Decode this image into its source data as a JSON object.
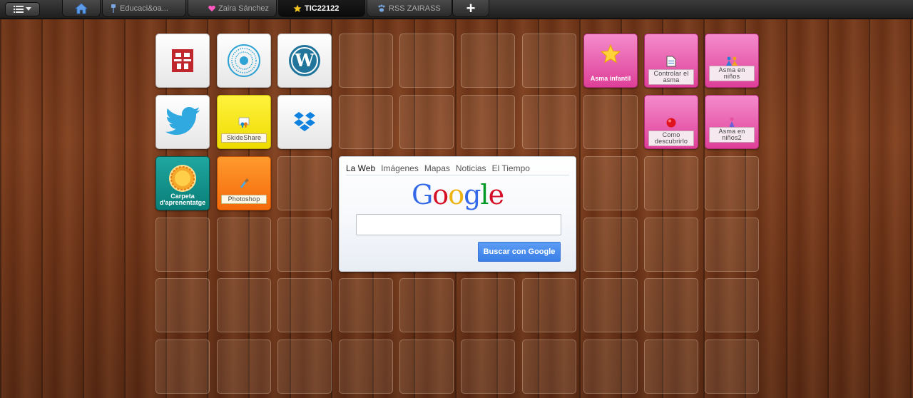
{
  "topbar": {
    "tabs": [
      {
        "label": "Educaci&oa...",
        "icon": "pin-icon",
        "active": false
      },
      {
        "label": "Zaira Sánchez",
        "icon": "heart-icon",
        "active": false
      },
      {
        "label": "TIC22122",
        "icon": "star-icon",
        "active": true
      },
      {
        "label": "RSS ZAIRASS",
        "icon": "paw-icon",
        "active": false
      }
    ],
    "add_label": "+"
  },
  "tiles": {
    "skideshare": "SkideShare",
    "carpeta_line1": "Carpeta",
    "carpeta_line2": "d'aprenentatge",
    "photoshop": "Photoshop",
    "asma_infantil": "Asma infantil",
    "controlar_line1": "Controlar el",
    "controlar_line2": "asma",
    "asma_ninos": "Asma en niños",
    "como_line1": "Como",
    "como_line2": "descubrirlo",
    "asma_ninos2": "Asma en niños2"
  },
  "google": {
    "tabs": [
      "La Web",
      "Imágenes",
      "Mapas",
      "Noticias",
      "El Tiempo"
    ],
    "logo_letters": [
      "G",
      "o",
      "o",
      "g",
      "l",
      "e"
    ],
    "logo_colors": [
      "#3369e8",
      "#d50f25",
      "#eeb211",
      "#3369e8",
      "#009925",
      "#d50f25"
    ],
    "search_value": "",
    "button_label": "Buscar con Google"
  },
  "colors": {
    "pink_tile": "#de3f98",
    "google_button": "#3b7fe8"
  }
}
